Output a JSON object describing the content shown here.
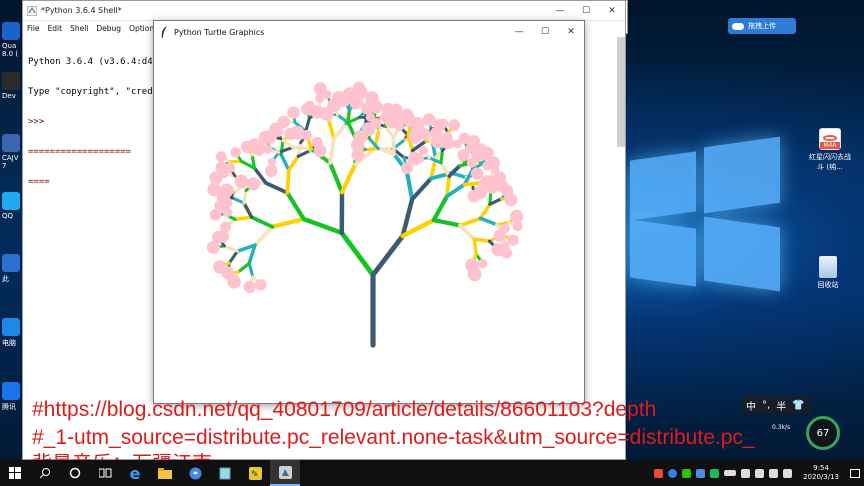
{
  "desktop": {
    "left_icons": [
      {
        "label": "Qua\n8.0 (",
        "color": "#1b63c9"
      },
      {
        "label": "Dev",
        "color": "#2a2a2a"
      },
      {
        "label": "CAJV\n7",
        "color": "#3a66b0"
      },
      {
        "label": "QQ",
        "color": "#1faaf0"
      },
      {
        "label": "此",
        "color": "#2d6fd0"
      },
      {
        "label": "电脑",
        "color": "#1e88e5"
      },
      {
        "label": "腾讯",
        "color": "#1a73e8"
      }
    ],
    "right_icons": [
      {
        "name": "m4a-file-icon",
        "label": "红星闪闪去战斗 (纯...",
        "badge": "M4A"
      },
      {
        "name": "recycle-bin-icon",
        "label": "回收站"
      }
    ],
    "upload_badge": "拖拽上传"
  },
  "shell_window": {
    "title": "*Python 3.6.4 Shell*",
    "menu": [
      "File",
      "Edit",
      "Shell",
      "Debug",
      "Option"
    ],
    "lines": [
      "Python 3.6.4 (v3.6.4:d48",
      "Type \"copyright\", \"credit",
      ">>>",
      "===================",
      "===="
    ]
  },
  "turtle_window": {
    "title": "Python Turtle Graphics"
  },
  "captions": [
    "#https://blog.csdn.net/qq_40801709/article/details/86601103?depth",
    "#_1-utm_source=distribute.pc_relevant.none-task&utm_source=distribute.pc_",
    "背景音乐：万疆江南"
  ],
  "ime": {
    "mode": "中",
    "punct": "°,",
    "width": "半"
  },
  "net": {
    "value": "67",
    "speed": "0.3k/s"
  },
  "taskbar": {
    "apps": [
      "windows-start",
      "search",
      "task-view",
      "cortana",
      "edge",
      "file-explorer",
      "sogou",
      "notepad",
      "idle",
      "python-turtle"
    ],
    "clock_time": "9:54",
    "clock_date": "2020/3/13"
  },
  "tree": {
    "colors": [
      "#3d5a73",
      "#13c422",
      "#ffd100",
      "#21b1c0",
      "#f8e2b8",
      "#ffc3cf"
    ]
  }
}
